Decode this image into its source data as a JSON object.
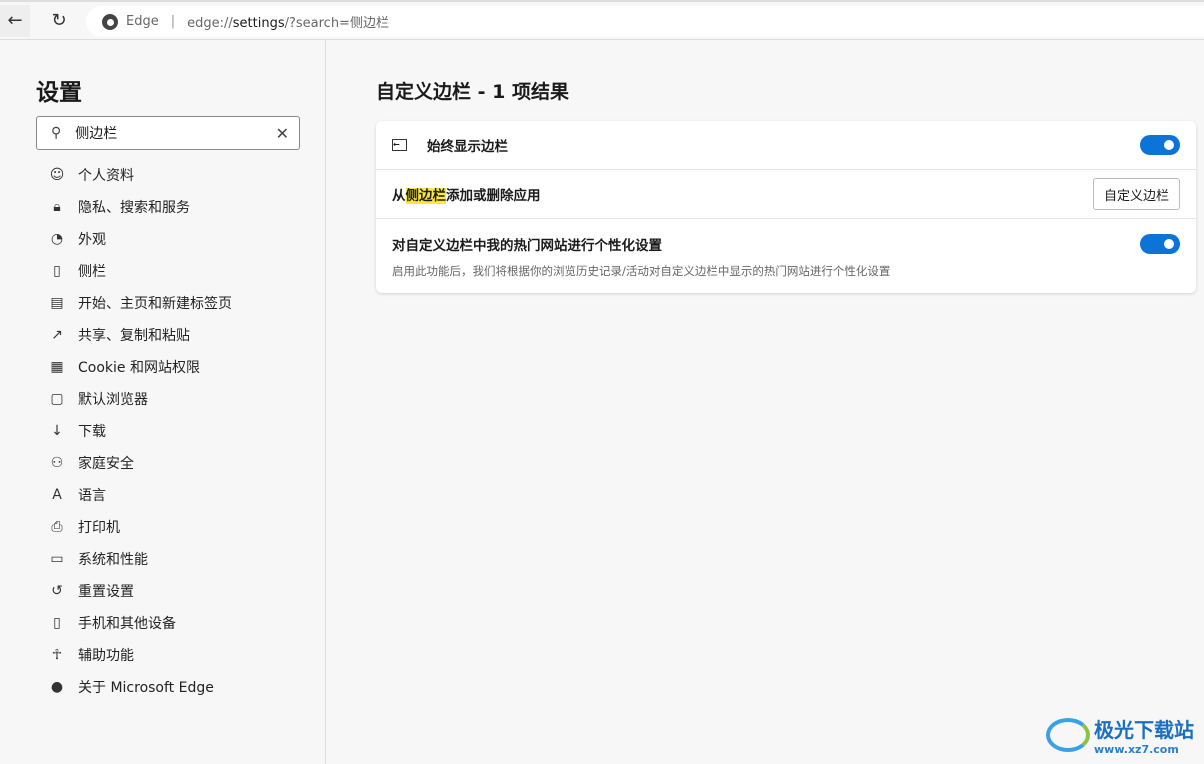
{
  "browser": {
    "brand": "Edge",
    "url_prefix": "edge://",
    "url_host": "settings",
    "url_rest": "/?search=侧边栏"
  },
  "sidebar": {
    "title": "设置",
    "search_value": "侧边栏",
    "items": [
      {
        "label": "个人资料",
        "icon": "profile-icon"
      },
      {
        "label": "隐私、搜索和服务",
        "icon": "lock-icon"
      },
      {
        "label": "外观",
        "icon": "palette-icon"
      },
      {
        "label": "侧栏",
        "icon": "sidebar-icon"
      },
      {
        "label": "开始、主页和新建标签页",
        "icon": "home-icon"
      },
      {
        "label": "共享、复制和粘贴",
        "icon": "share-icon"
      },
      {
        "label": "Cookie 和网站权限",
        "icon": "cookie-icon"
      },
      {
        "label": "默认浏览器",
        "icon": "browser-icon"
      },
      {
        "label": "下载",
        "icon": "download-icon"
      },
      {
        "label": "家庭安全",
        "icon": "family-icon"
      },
      {
        "label": "语言",
        "icon": "language-icon"
      },
      {
        "label": "打印机",
        "icon": "printer-icon"
      },
      {
        "label": "系统和性能",
        "icon": "laptop-icon"
      },
      {
        "label": "重置设置",
        "icon": "reset-icon"
      },
      {
        "label": "手机和其他设备",
        "icon": "phone-icon"
      },
      {
        "label": "辅助功能",
        "icon": "accessibility-icon"
      },
      {
        "label": "关于 Microsoft Edge",
        "icon": "edge-icon"
      }
    ]
  },
  "main": {
    "title": "自定义边栏 - 1 项结果",
    "row1": {
      "label": "始终显示边栏",
      "toggle_on": true
    },
    "row2": {
      "pre": "从",
      "highlight": "侧边栏",
      "post": "添加或删除应用",
      "button": "自定义边栏"
    },
    "row3": {
      "label": "对自定义边栏中我的热门网站进行个性化设置",
      "desc": "启用此功能后，我们将根据你的浏览历史记录/活动对自定义边栏中显示的热门网站进行个性化设置",
      "toggle_on": true
    }
  },
  "watermark": {
    "name": "极光下载站",
    "site": "www.xz7.com"
  },
  "colors": {
    "accent": "#0c74d6",
    "highlight": "#fde934"
  }
}
